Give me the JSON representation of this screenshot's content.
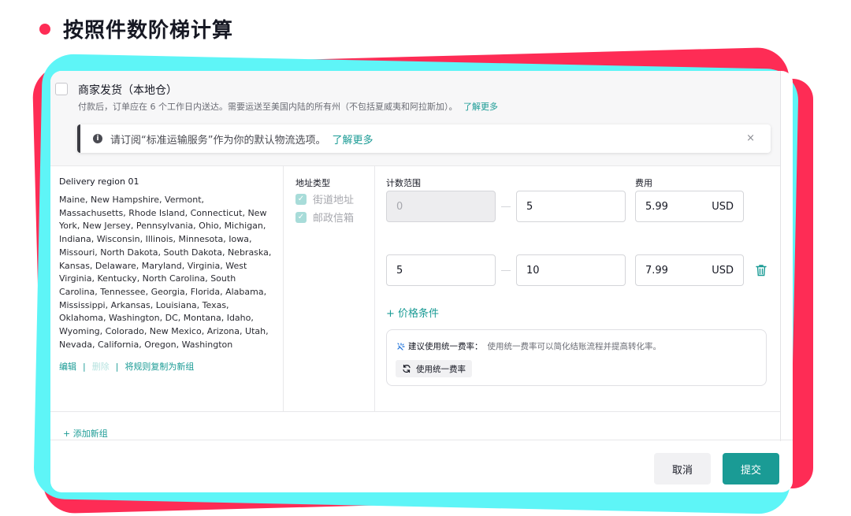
{
  "page_title": "按照件数阶梯计算",
  "merchant": {
    "title": "商家发货（本地仓）",
    "description": "付款后，订单应在 6 个工作日内送达。需要运送至美国内陆的所有州（不包括夏威夷和阿拉斯加）。",
    "learn_more": "了解更多"
  },
  "notice": {
    "text": "请订阅“标准运输服务”作为你的默认物流选项。",
    "link": "了解更多",
    "close": "×"
  },
  "region": {
    "title": "Delivery region 01",
    "states": "Maine, New Hampshire, Vermont, Massachusetts, Rhode Island, Connecticut, New York, New Jersey, Pennsylvania, Ohio, Michigan, Indiana, Wisconsin, Illinois, Minnesota, Iowa, Missouri, North Dakota, South Dakota, Nebraska, Kansas, Delaware, Maryland, Virginia, West Virginia, Kentucky, North Carolina, South Carolina, Tennessee, Georgia, Florida, Alabama, Mississippi, Arkansas, Louisiana, Texas, Oklahoma, Washington, DC, Montana, Idaho, Wyoming, Colorado, New Mexico, Arizona, Utah, Nevada, California, Oregon, Washington",
    "actions": {
      "edit": "编辑",
      "delete": "删除",
      "copy": "将规则复制为新组",
      "sep": "|"
    }
  },
  "address": {
    "label": "地址类型",
    "options": [
      {
        "label": "街道地址",
        "checked": true
      },
      {
        "label": "邮政信箱",
        "checked": true
      }
    ]
  },
  "tiers": {
    "count_label": "计数范围",
    "fee_label": "费用",
    "currency": "USD",
    "rows": [
      {
        "from": "0",
        "to": "5",
        "fee": "5.99"
      },
      {
        "from": "5",
        "to": "10",
        "fee": "7.99"
      }
    ]
  },
  "add_condition": "+ 价格条件",
  "suggestion": {
    "title": "建议使用统一费率：",
    "text": "使用统一费率可以简化结账流程并提高转化率。",
    "button": "使用统一费率"
  },
  "add_group": "+ 添加新组",
  "footer": {
    "cancel": "取消",
    "submit": "提交"
  },
  "colors": {
    "brand_red": "#fe2c55",
    "brand_cyan": "#5ef5f7",
    "accent": "#1a9b95"
  }
}
